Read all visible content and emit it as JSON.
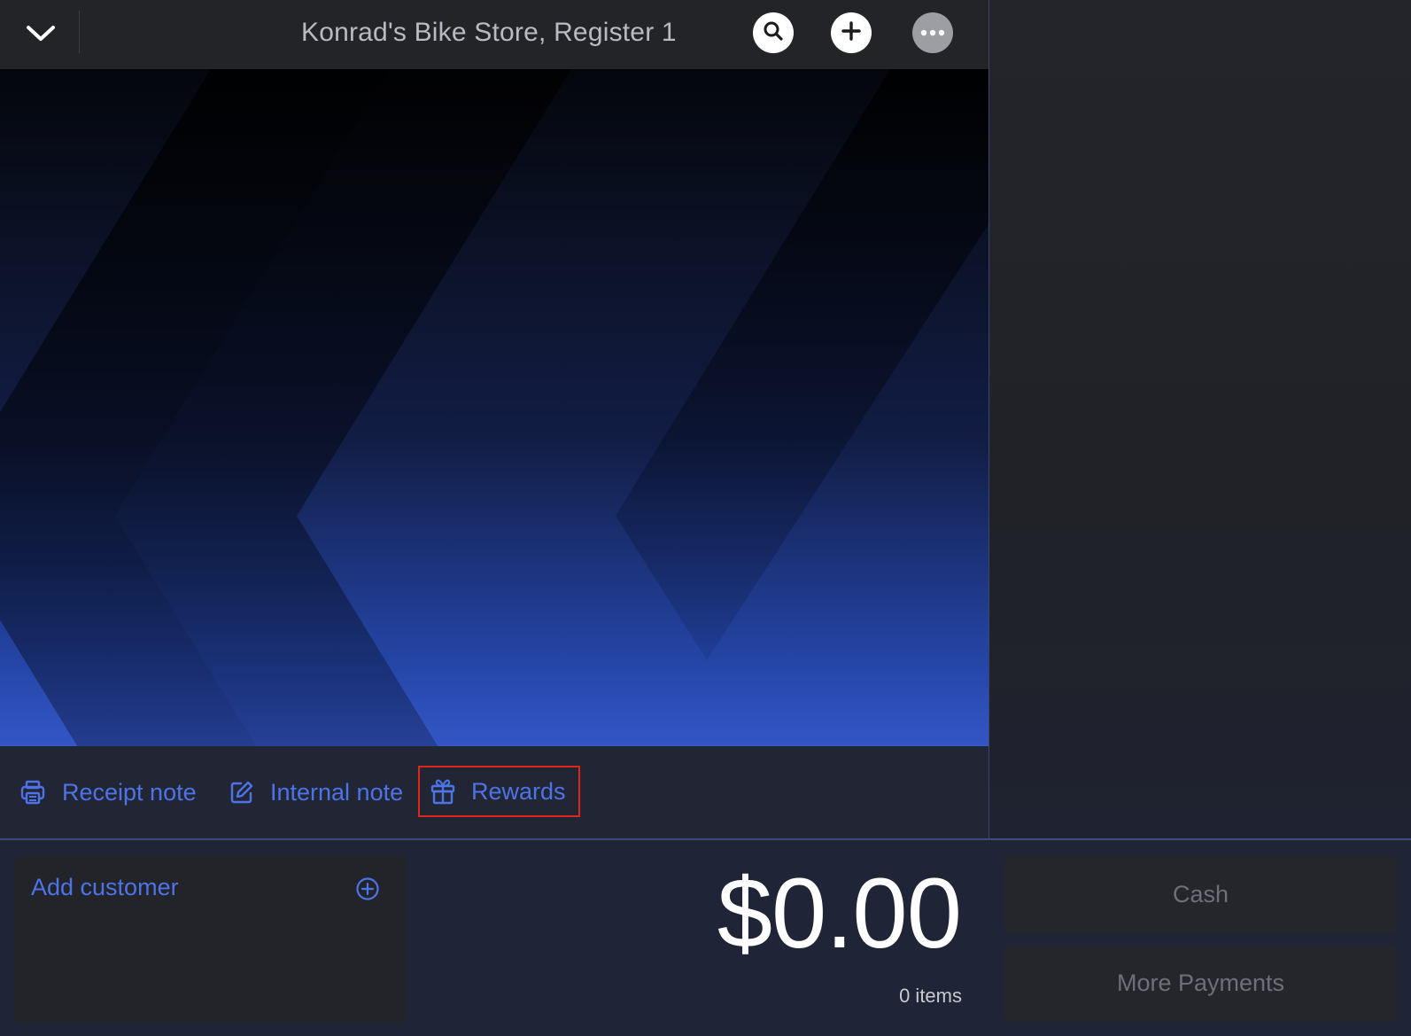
{
  "header": {
    "title": "Konrad's Bike Store, Register 1",
    "icons": {
      "back": "chevron-down-icon",
      "search": "search-icon",
      "add": "plus-icon",
      "more": "more-icon"
    }
  },
  "notes": {
    "receipt_note": "Receipt note",
    "internal_note": "Internal note",
    "rewards": "Rewards"
  },
  "customer": {
    "add_label": "Add customer"
  },
  "sale": {
    "total": "$0.00",
    "items": "0 items"
  },
  "payments": {
    "cash": "Cash",
    "more": "More Payments"
  },
  "colors": {
    "accent": "#4d73e8",
    "highlight_border": "#e0251b",
    "topbar": "#232428"
  }
}
